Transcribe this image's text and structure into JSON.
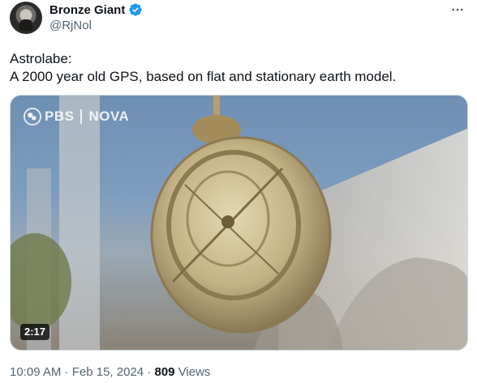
{
  "author": {
    "display_name": "Bronze Giant",
    "handle": "@RjNol",
    "verified": true
  },
  "more_icon": "more-horizontal-icon",
  "tweet": {
    "line1": "Astrolabe:",
    "line2": "A 2000 year old GPS, based on flat and stationary earth model."
  },
  "media": {
    "watermark_brand": "PBS",
    "watermark_show": "NOVA",
    "duration": "2:17"
  },
  "meta": {
    "time": "10:09 AM",
    "date": "Feb 15, 2024",
    "separator": "·",
    "views_count": "809",
    "views_label": "Views"
  },
  "colors": {
    "verified_badge": "#1d9bf0",
    "secondary_text": "#536471",
    "primary_text": "#0f1419"
  }
}
